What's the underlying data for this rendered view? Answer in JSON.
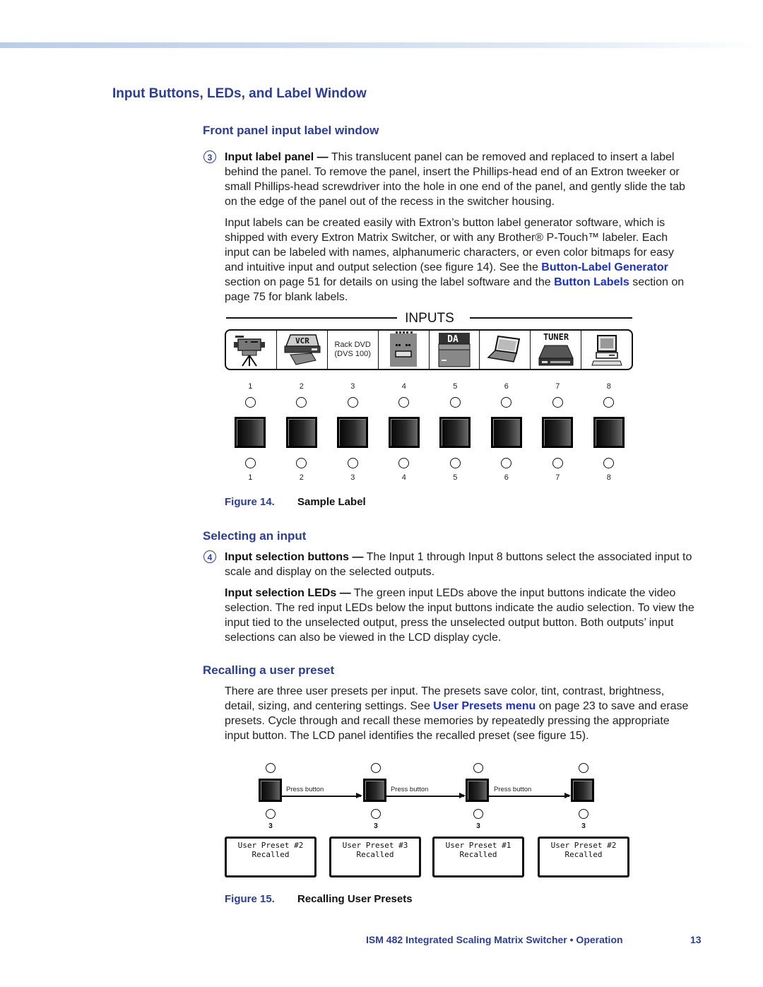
{
  "page": {
    "section_title": "Input Buttons, LEDs, and Label Window",
    "footer": "ISM 482 Integrated Scaling Matrix Switcher • Operation",
    "page_number": "13"
  },
  "label_window": {
    "heading": "Front panel input label window",
    "callout": "3",
    "p1_bold": "Input label panel —",
    "p1_text": " This translucent panel can be removed and replaced to insert a label behind the panel.  To remove the panel, insert the Phillips-head end of an Extron tweeker or small Phillips-head screwdriver into the hole in one end of the panel, and gently slide the tab on the edge of the panel out of the recess in the switcher housing.",
    "p2_text_a": "Input labels can be created easily with Extron’s button label generator software, which is shipped with every Extron Matrix Switcher, or with any Brother® P-Touch™ labeler. Each input can be labeled with names, alphanumeric characters, or even color bitmaps for easy and intuitive input and output selection (see figure 14).  See the ",
    "p2_link1": "Button-Label Generator",
    "p2_text_b": " section on page 51 for details on using the label software and the ",
    "p2_link2": "Button Labels",
    "p2_text_c": " section on page 75 for blank labels."
  },
  "figure14": {
    "inputs_title": "INPUTS",
    "labels": [
      {
        "icon": "camcorder-icon"
      },
      {
        "icon": "vcr-icon",
        "text": "VCR"
      },
      {
        "icon": "text",
        "text": "Rack DVD\n(DVS 100)",
        "line1": "Rack DVD",
        "line2": "(DVS 100)"
      },
      {
        "icon": "rack-device-icon"
      },
      {
        "icon": "da-icon",
        "text": "DA"
      },
      {
        "icon": "laptop-icon"
      },
      {
        "icon": "tuner-icon",
        "text": "TUNER"
      },
      {
        "icon": "desktop-computer-icon"
      }
    ],
    "numbers": [
      "1",
      "2",
      "3",
      "4",
      "5",
      "6",
      "7",
      "8"
    ],
    "caption_number": "Figure 14.",
    "caption_title": "Sample Label"
  },
  "selecting": {
    "heading": "Selecting an input",
    "callout": "4",
    "p1_bold": "Input selection buttons —",
    "p1_text": " The Input 1 through Input 8 buttons select the associated input to scale and display on the selected outputs.",
    "p2_bold": "Input selection LEDs —",
    "p2_text": " The green input LEDs above the input buttons indicate the video selection.  The red input LEDs below the input buttons indicate the audio selection.  To view the input tied to the unselected output, press the unselected output button.  Both outputs’ input selections can also be viewed in the LCD display cycle."
  },
  "presets": {
    "heading": "Recalling a user preset",
    "p_text_a": "There are three user presets per input.  The presets save color, tint, contrast, brightness, detail, sizing, and centering settings.  See ",
    "p_link": "User Presets menu",
    "p_text_b": " on page 23 to save and erase presets.  Cycle through and recall these memories by repeatedly pressing the appropriate input button.  The LCD panel identifies the recalled preset (see figure 15)."
  },
  "figure15": {
    "press_label": "Press button",
    "input_number": "3",
    "steps": [
      {
        "line1": "User Preset #2",
        "line2": "Recalled"
      },
      {
        "line1": "User Preset #3",
        "line2": "Recalled"
      },
      {
        "line1": "User Preset #1",
        "line2": "Recalled"
      },
      {
        "line1": "User Preset #2",
        "line2": "Recalled"
      }
    ],
    "caption_number": "Figure 15.",
    "caption_title": "Recalling User Presets"
  }
}
